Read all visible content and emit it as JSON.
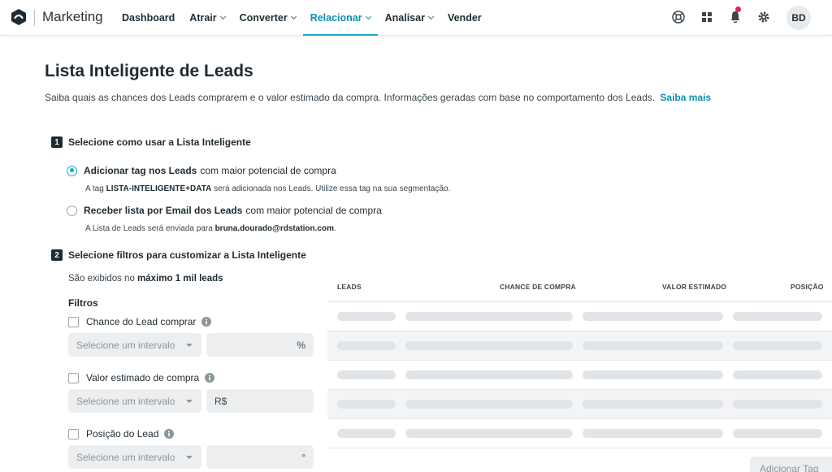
{
  "app": {
    "brand": "Marketing",
    "avatar_initials": "BD"
  },
  "nav": {
    "items": [
      {
        "label": "Dashboard",
        "caret": false,
        "active": false
      },
      {
        "label": "Atrair",
        "caret": true,
        "active": false
      },
      {
        "label": "Converter",
        "caret": true,
        "active": false
      },
      {
        "label": "Relacionar",
        "caret": true,
        "active": true
      },
      {
        "label": "Analisar",
        "caret": true,
        "active": false
      },
      {
        "label": "Vender",
        "caret": false,
        "active": false
      }
    ]
  },
  "page": {
    "title": "Lista Inteligente de Leads",
    "description": "Saiba quais as chances dos Leads comprarem e o valor estimado da compra. Informações geradas com base no comportamento dos Leads.",
    "learn_more": "Saiba mais"
  },
  "step1": {
    "number": "1",
    "title": "Selecione como usar a Lista Inteligente",
    "options": [
      {
        "bold": "Adicionar tag nos Leads",
        "rest": "com maior potencial de compra",
        "selected": true,
        "sub_prefix": "A tag",
        "sub_bold": "LISTA-INTELIGENTE+DATA",
        "sub_suffix": "será adicionada nos Leads. Utilize essa tag na sua segmentação."
      },
      {
        "bold": "Receber lista por Email dos Leads",
        "rest": "com maior potencial de compra",
        "selected": false,
        "sub_prefix": "A Lista de Leads será enviada para",
        "sub_bold": "bruna.dourado@rdstation.com",
        "sub_suffix": "."
      }
    ]
  },
  "step2": {
    "number": "2",
    "title": "Selecione filtros para customizar a Lista Inteligente",
    "limit_prefix": "São exibidos no",
    "limit_bold": "máximo 1 mil leads",
    "filters_title": "Filtros",
    "filters": [
      {
        "label": "Chance do Lead comprar",
        "select_placeholder": "Selecione um intervalo",
        "unit": "%"
      },
      {
        "label": "Valor estimado de compra",
        "select_placeholder": "Selecione um intervalo",
        "unit": "R$"
      },
      {
        "label": "Posição do Lead",
        "select_placeholder": "Selecione um intervalo",
        "unit": "°"
      }
    ]
  },
  "table": {
    "headers": [
      "LEADS",
      "CHANCE DE COMPRA",
      "VALOR ESTIMADO",
      "POSIÇÃO"
    ],
    "loading_rows": 5
  },
  "actions": {
    "add_tag": "Adicionar Tag"
  },
  "colors": {
    "accent": "#1aa6c8",
    "link": "#0d8fb0",
    "notification": "#e0245e"
  },
  "icons": [
    "logo-icon",
    "help-icon",
    "apps-grid-icon",
    "bell-icon",
    "gear-icon",
    "info-icon"
  ]
}
